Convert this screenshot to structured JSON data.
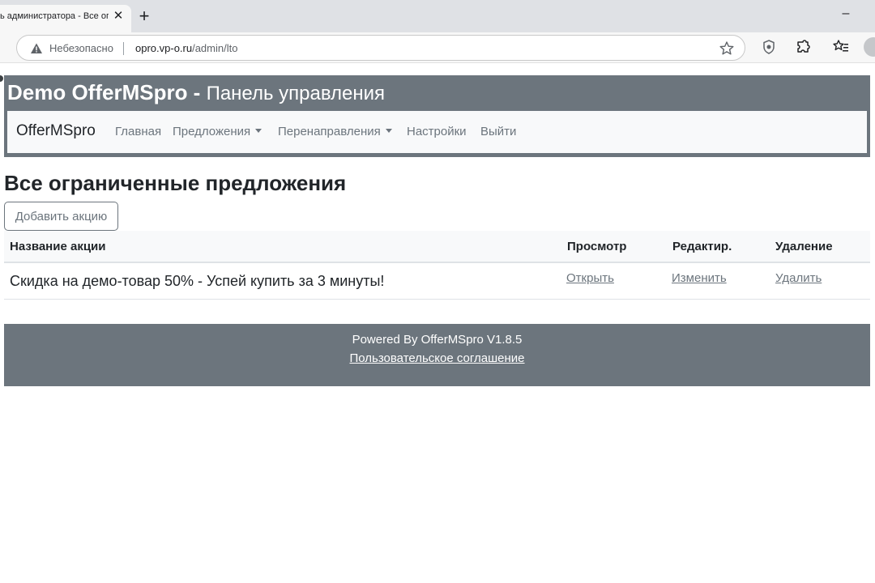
{
  "browser": {
    "tab_title": "ь администратора - Все ог",
    "insecure_label": "Небезопасно",
    "url_host": "opro.vp-o.ru",
    "url_path": "/admin/lto"
  },
  "header": {
    "title": "Demo OfferMSpro -",
    "subtitle": "Панель управления"
  },
  "nav": {
    "brand": "OfferMSpro",
    "items": [
      {
        "label": "Главная"
      },
      {
        "label": "Предложения"
      },
      {
        "label": "Перенаправления"
      },
      {
        "label": "Настройки"
      },
      {
        "label": "Выйти"
      }
    ]
  },
  "main": {
    "heading": "Все ограниченные предложения",
    "add_button": "Добавить акцию",
    "table": {
      "columns": [
        "Название акции",
        "Просмотр",
        "Редактир.",
        "Удаление"
      ],
      "rows": [
        {
          "title": "Скидка на демо-товар 50% - Успей купить за 3 минуты!",
          "view": "Открыть",
          "edit": "Изменить",
          "delete": "Удалить"
        }
      ]
    }
  },
  "footer": {
    "powered": "Powered By OfferMSpro V1.8.5",
    "agreement": "Пользовательское соглашение"
  },
  "colors": {
    "header_bg": "#6c757d",
    "navbar_bg": "#f8f9fa",
    "footer_bg": "#6c757d"
  },
  "icons": [
    "warning-icon",
    "star-icon",
    "shield-icon",
    "extensions-icon",
    "favorites-icon",
    "close-icon",
    "new-tab-icon",
    "minimize-icon",
    "caret-down-icon"
  ]
}
